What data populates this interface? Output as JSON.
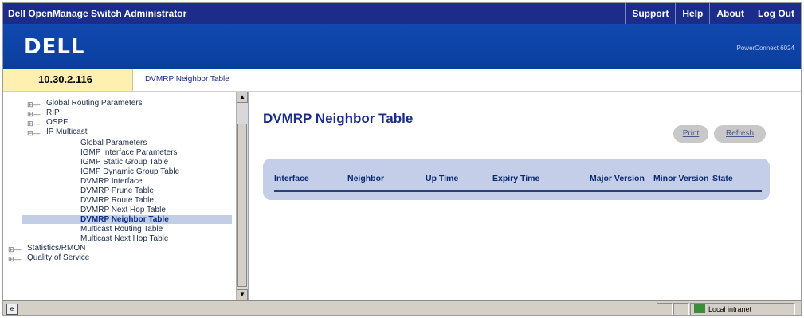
{
  "app": {
    "title": "Dell OpenManage Switch Administrator",
    "nav": [
      "Support",
      "Help",
      "About",
      "Log Out"
    ],
    "logo": "DELL",
    "product": "PowerConnect 6024"
  },
  "location": {
    "ip": "10.30.2.116",
    "breadcrumb": "DVMRP Neighbor Table"
  },
  "tree": {
    "items": [
      {
        "label": "Global Routing Parameters",
        "expander": "+"
      },
      {
        "label": "RIP",
        "expander": "+"
      },
      {
        "label": "OSPF",
        "expander": "+"
      },
      {
        "label": "IP Multicast",
        "expander": "-"
      },
      {
        "label": "Global Parameters"
      },
      {
        "label": "IGMP Interface Parameters"
      },
      {
        "label": "IGMP Static Group Table"
      },
      {
        "label": "IGMP Dynamic Group Table"
      },
      {
        "label": "DVMRP Interface"
      },
      {
        "label": "DVMRP Prune Table"
      },
      {
        "label": "DVMRP Route Table"
      },
      {
        "label": "DVMRP Next Hop Table"
      },
      {
        "label": "DVMRP Neighbor Table",
        "selected": true
      },
      {
        "label": "Multicast Routing Table"
      },
      {
        "label": "Multicast Next Hop Table"
      },
      {
        "label": "Statistics/RMON",
        "expander": "+"
      },
      {
        "label": "Quality of Service",
        "expander": "+"
      }
    ]
  },
  "main": {
    "title": "DVMRP Neighbor Table",
    "print_label": "Print",
    "refresh_label": "Refresh",
    "columns": [
      "Interface",
      "Neighbor",
      "Up Time",
      "Expiry Time",
      "Major Version",
      "Minor Version",
      "State"
    ]
  },
  "status": {
    "zone": "Local intranet"
  },
  "colors": {
    "topbar": "#1c2c8a",
    "brand": "#0a3e9e",
    "ipbox": "#ffefb0",
    "table_header_bg": "#c5cee8"
  }
}
